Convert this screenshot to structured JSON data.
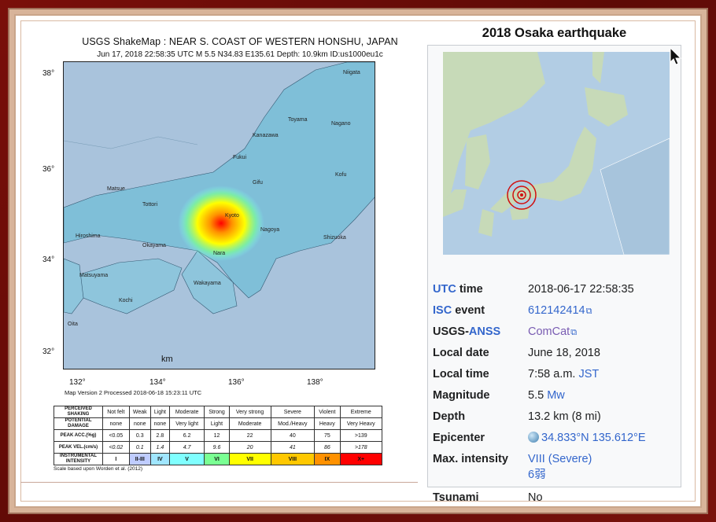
{
  "shakemap": {
    "title": "USGS ShakeMap : NEAR S. COAST OF WESTERN HONSHU, JAPAN",
    "subtitle": "Jun 17, 2018 22:58:35 UTC   M 5.5   N34.83 E135.61   Depth: 10.9km   ID:us1000eu1c",
    "lat_labels": [
      "38°",
      "36°",
      "34°",
      "32°"
    ],
    "lon_labels": [
      "132°",
      "134°",
      "136°",
      "138°"
    ],
    "scale": {
      "unit": "km",
      "ticks": [
        "0",
        "75",
        "150"
      ]
    },
    "places": [
      "Niigata",
      "Nagano",
      "Toyama",
      "Kanazawa",
      "Fukui",
      "Gifu",
      "Kofu",
      "Matsue",
      "Tottori",
      "Kyoto",
      "Nara",
      "Nagoya",
      "Shizuoka",
      "Wakayama",
      "Okayama",
      "Hiroshima",
      "Kochi",
      "Matsuyama",
      "Oita"
    ],
    "map_version": "Map Version 2 Processed 2018-06-18 15:23:11 UTC",
    "table": {
      "rows": [
        {
          "label": "PERCEIVED SHAKING",
          "cells": [
            "Not felt",
            "Weak",
            "Light",
            "Moderate",
            "Strong",
            "Very strong",
            "Severe",
            "Violent",
            "Extreme"
          ]
        },
        {
          "label": "POTENTIAL DAMAGE",
          "cells": [
            "none",
            "none",
            "none",
            "Very light",
            "Light",
            "Moderate",
            "Mod./Heavy",
            "Heavy",
            "Very Heavy"
          ]
        },
        {
          "label": "PEAK ACC.(%g)",
          "cells": [
            "<0.05",
            "0.3",
            "2.8",
            "6.2",
            "12",
            "22",
            "40",
            "75",
            ">139"
          ]
        },
        {
          "label": "PEAK VEL.(cm/s)",
          "cells": [
            "<0.02",
            "0.1",
            "1.4",
            "4.7",
            "9.6",
            "20",
            "41",
            "86",
            ">178"
          ]
        },
        {
          "label": "INSTRUMENTAL INTENSITY",
          "cells": [
            "I",
            "II-III",
            "IV",
            "V",
            "VI",
            "VII",
            "VIII",
            "IX",
            "X+"
          ]
        }
      ],
      "intensity_colors": [
        "#ffffff",
        "#bfccff",
        "#a0e6ff",
        "#80ffff",
        "#7aff93",
        "#ffff00",
        "#ffc800",
        "#ff9100",
        "#ff0000"
      ],
      "note": "Scale based upon Worden et al. (2012)"
    }
  },
  "infobox": {
    "title": "2018 Osaka earthquake",
    "rows": [
      {
        "key": "UTC time",
        "key_link": "UTC",
        "value": "2018-06-17 22:58:35"
      },
      {
        "key": "ISC event",
        "key_link": "ISC",
        "value": "612142414"
      },
      {
        "key": "USGS-ANSS",
        "key_link": "ANSS",
        "value": "ComCat"
      },
      {
        "key": "Local date",
        "value": "June 18, 2018"
      },
      {
        "key": "Local time",
        "value": "7:58 a.m.",
        "value_link": "JST"
      },
      {
        "key": "Magnitude",
        "value": "5.5",
        "value_link": "Mw"
      },
      {
        "key": "Depth",
        "value": "13.2 km (8 mi)"
      },
      {
        "key": "Epicenter",
        "value": "34.833°N 135.612°E"
      },
      {
        "key": "Max. intensity",
        "value": "VIII (Severe)",
        "value2": "6弱"
      },
      {
        "key": "Tsunami",
        "value": "No"
      }
    ]
  }
}
